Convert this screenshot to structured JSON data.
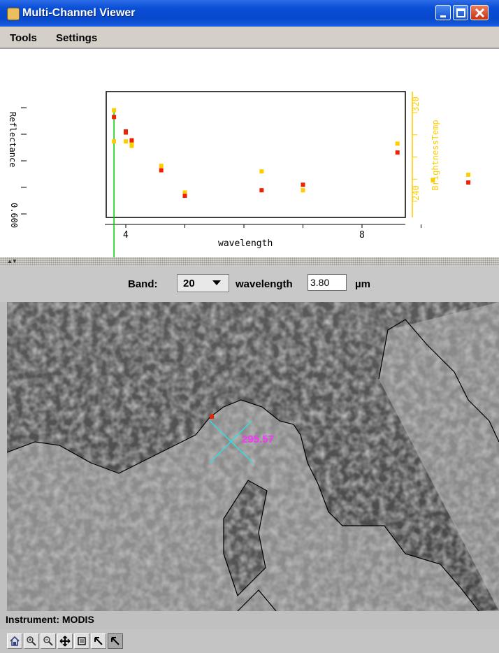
{
  "window": {
    "title": "Multi-Channel Viewer"
  },
  "menu": [
    {
      "label": "Tools"
    },
    {
      "label": "Settings"
    }
  ],
  "chart_data": {
    "type": "scatter",
    "xlabel": "wavelength",
    "ylabel_left": "Reflectance",
    "ylabel_right": "BrightnessTemp",
    "left_tick_labels": [
      "0.600"
    ],
    "right_tick_labels": [
      "240",
      "320"
    ],
    "x_tick_labels": [
      "4",
      "8"
    ],
    "xlim": [
      3.5,
      9.3
    ],
    "ylim_right": [
      235,
      330
    ],
    "selected_wavelength": 3.8,
    "series": [
      {
        "color": "#ffcc00",
        "points": [
          [
            3.8,
            322
          ],
          [
            3.8,
            294
          ],
          [
            4.0,
            294
          ],
          [
            4.1,
            290
          ],
          [
            4.1,
            293
          ],
          [
            4.6,
            272
          ],
          [
            5.0,
            248
          ],
          [
            6.3,
            267
          ],
          [
            7.0,
            250
          ],
          [
            8.6,
            292
          ],
          [
            9.2,
            259
          ],
          [
            9.8,
            264
          ]
        ]
      },
      {
        "color": "#ee2200",
        "points": [
          [
            3.8,
            316
          ],
          [
            4.0,
            303
          ],
          [
            4.0,
            302
          ],
          [
            4.1,
            295
          ],
          [
            4.6,
            268
          ],
          [
            5.0,
            245
          ],
          [
            6.3,
            250
          ],
          [
            7.0,
            255
          ],
          [
            8.6,
            284
          ],
          [
            9.8,
            257
          ]
        ]
      }
    ],
    "axis_color": "#000000",
    "right_axis_color": "#ffcc00",
    "selected_line_color": "#00cc00"
  },
  "band": {
    "label": "Band:",
    "value": "20",
    "wavelength_label": "wavelength",
    "wavelength_value": "3.80",
    "unit": "µm"
  },
  "image": {
    "readout": "295.57",
    "readout_color": "#ff33ff",
    "cursor_color": "#33dddd"
  },
  "status": {
    "instrument": "Instrument: MODIS"
  },
  "toolbar": [
    {
      "icon": "home-icon"
    },
    {
      "icon": "zoom-in-icon"
    },
    {
      "icon": "zoom-out-icon"
    },
    {
      "icon": "pan-icon"
    },
    {
      "icon": "reset-view-icon"
    },
    {
      "icon": "pointer-icon"
    },
    {
      "icon": "select-pointer-icon",
      "pressed": true
    }
  ]
}
